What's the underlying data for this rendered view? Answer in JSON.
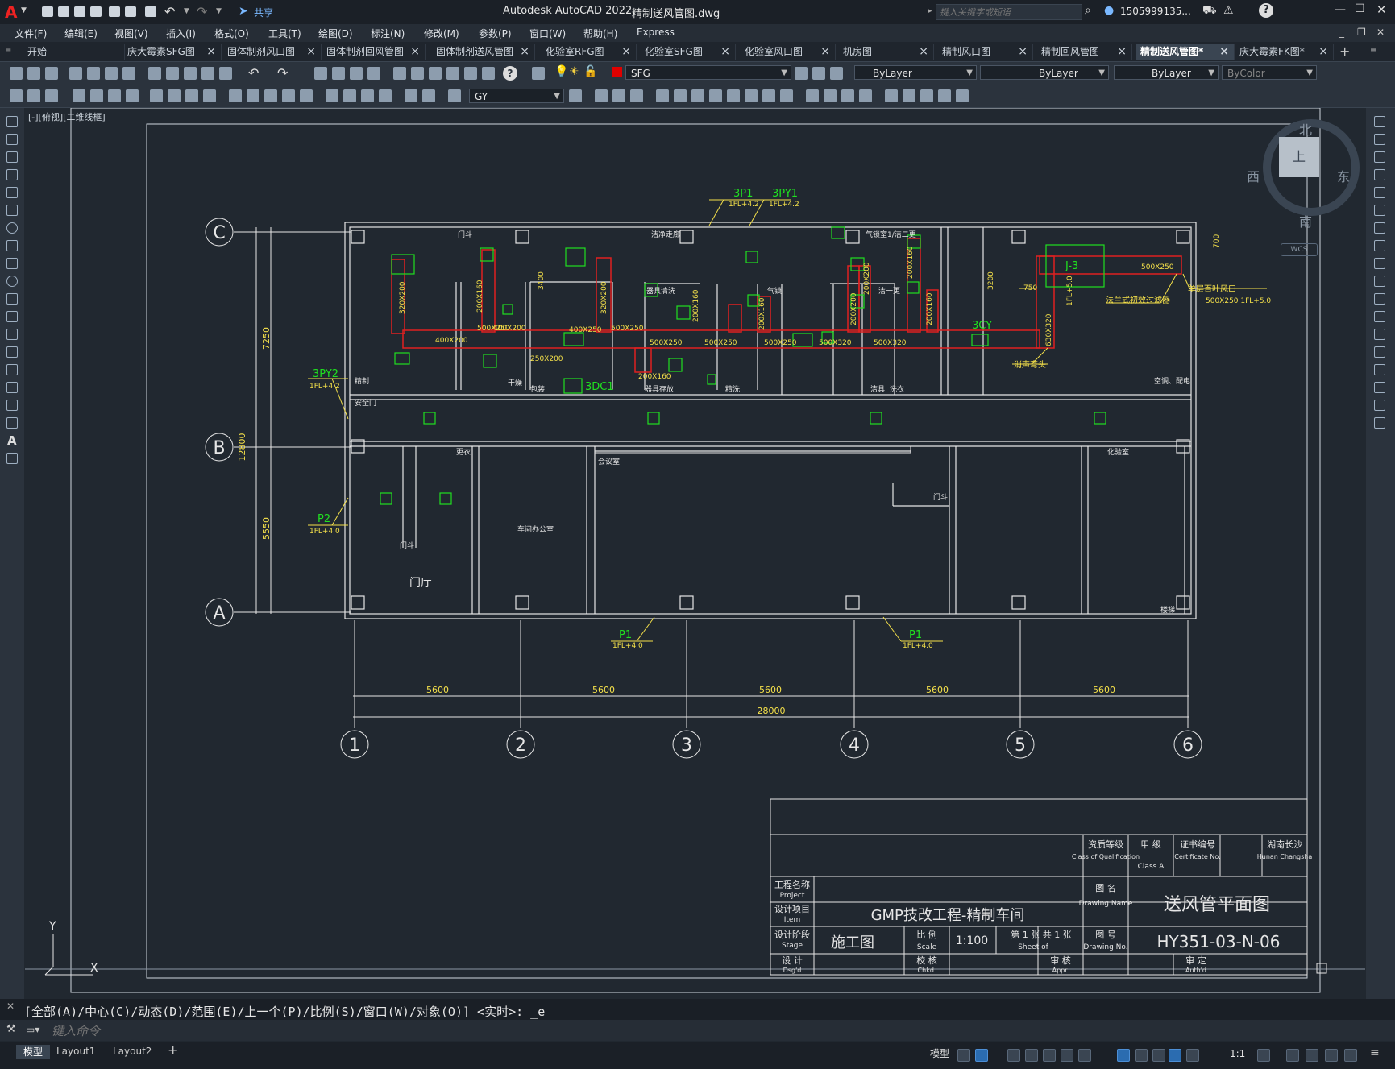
{
  "app": {
    "title": "Autodesk AutoCAD 2022",
    "file_name": "精制送风管图.dwg",
    "share_label": "共享",
    "search_placeholder": "键入关键字或短语",
    "user": "1505999135...",
    "logo_letter": "A"
  },
  "menu": [
    "文件(F)",
    "编辑(E)",
    "视图(V)",
    "插入(I)",
    "格式(O)",
    "工具(T)",
    "绘图(D)",
    "标注(N)",
    "修改(M)",
    "参数(P)",
    "窗口(W)",
    "帮助(H)",
    "Express"
  ],
  "tabs": [
    {
      "label": "开始",
      "close": false,
      "active": false
    },
    {
      "label": "庆大霉素SFG图",
      "close": true,
      "active": false
    },
    {
      "label": "固体制剂风口图",
      "close": true,
      "active": false
    },
    {
      "label": "固体制剂回风管图",
      "close": true,
      "active": false
    },
    {
      "label": "固体制剂送风管图",
      "close": true,
      "active": false
    },
    {
      "label": "化验室RFG图",
      "close": true,
      "active": false
    },
    {
      "label": "化验室SFG图",
      "close": true,
      "active": false
    },
    {
      "label": "化验室风口图",
      "close": true,
      "active": false
    },
    {
      "label": "机房图",
      "close": true,
      "active": false
    },
    {
      "label": "精制风口图",
      "close": true,
      "active": false
    },
    {
      "label": "精制回风管图",
      "close": true,
      "active": false
    },
    {
      "label": "精制送风管图*",
      "close": true,
      "active": true
    },
    {
      "label": "庆大霉素FK图*",
      "close": true,
      "active": false
    }
  ],
  "toolbar": {
    "layer": "SFG",
    "color": "ByLayer",
    "linetype": "ByLayer",
    "lineweight": "ByLayer",
    "plotstyle": "ByColor",
    "textstyle": "GY",
    "layer_color": "#e00000"
  },
  "viewport": {
    "label": "[-][俯视][二维线框]",
    "viewcube": {
      "top": "上",
      "north": "北",
      "south": "南",
      "east": "东",
      "west": "西",
      "wcs": "WCS"
    },
    "ucs_x": "X",
    "ucs_y": "Y"
  },
  "drawing": {
    "grid_rows": [
      "C",
      "B",
      "A"
    ],
    "grid_cols": [
      "1",
      "2",
      "3",
      "4",
      "5",
      "6"
    ],
    "bay_dims": [
      "5600",
      "5600",
      "5600",
      "5600",
      "5600"
    ],
    "total_dim": "28000",
    "left_dims": {
      "top": "7250",
      "bottom": "5550",
      "total": "12800"
    },
    "duct_sizes": [
      "320X200",
      "200X160",
      "400X200",
      "400X200",
      "400X250",
      "320X200",
      "500X250",
      "250X200",
      "500X250",
      "500X250",
      "200X160",
      "200X160",
      "500X250",
      "500X320",
      "200X160",
      "200X200",
      "500X320",
      "200X200",
      "200X160",
      "630X320",
      "500X250",
      "200X160",
      "500X250"
    ],
    "equipment": [
      {
        "tag": "3P1",
        "elev": "1FL+4.2"
      },
      {
        "tag": "3PY1",
        "elev": "1FL+4.2"
      },
      {
        "tag": "3PY2",
        "elev": "1FL+4.2"
      },
      {
        "tag": "P2",
        "elev": "1FL+4.0"
      },
      {
        "tag": "P1",
        "elev": "1FL+4.0"
      },
      {
        "tag": "P1",
        "elev": "1FL+4.0"
      }
    ],
    "labels": {
      "j3": "J-3",
      "cy": "3CY",
      "dc1": "3DC1",
      "louver": "单层百叶风口",
      "louver_spec": "500X250  1FL+5.0",
      "filter": "法兰式初效过滤器",
      "silencer": "消声弯头",
      "elev_vertical": "1FL+5.0",
      "dim_750": "750",
      "dim_700": "700",
      "dim_3400": "3400",
      "dim_3200": "3200"
    },
    "rooms": [
      "门斗",
      "洁净走廊",
      "气锁室1/洁二更",
      "洁一更",
      "器具清洗",
      "气锁",
      "器具存放",
      "安全门",
      "干燥",
      "包装",
      "精制",
      "精洗",
      "洁具",
      "洗衣",
      "空调、配电",
      "更衣",
      "车间办公室",
      "门厅",
      "会议室",
      "门斗",
      "化验室",
      "楼梯",
      "门斗"
    ]
  },
  "title_block": {
    "qual_label": "资质等级",
    "qual_en": "Class of Qualification",
    "grade_label": "甲 级",
    "grade_en": "Class A",
    "cert_label": "证书编号",
    "cert_en": "Certificate No.",
    "location": "湖南长沙",
    "location_en": "Hunan Changsha",
    "project_label": "工程名称",
    "project_en": "Project",
    "item_label": "设计项目",
    "item_en": "Item",
    "project_name": "GMP技改工程-精制车间",
    "drawing_name_label": "图  名",
    "drawing_name_en": "Drawing Name",
    "drawing_name": "送风管平面图",
    "stage_label": "设计阶段",
    "stage_en": "Stage",
    "stage": "施工图",
    "scale_label": "比  例",
    "scale_en": "Scale",
    "scale": "1:100",
    "sheet_label": "第 1 张 共 1 张",
    "sheet_en": "Sheet    of",
    "drawing_no_label": "图  号",
    "drawing_no_en": "Drawing No.",
    "drawing_no": "HY351-03-N-06",
    "design_label": "设  计",
    "design_en": "Dsg'd",
    "check_label": "校  核",
    "check_en": "Chkd.",
    "review_label": "审  核",
    "review_en": "Appr.",
    "approve_label": "审  定",
    "approve_en": "Auth'd"
  },
  "command": {
    "history": "[全部(A)/中心(C)/动态(D)/范围(E)/上一个(P)/比例(S)/窗口(W)/对象(O)] <实时>: _e",
    "placeholder": "键入命令"
  },
  "status": {
    "layout_tabs": [
      "模型",
      "Layout1",
      "Layout2"
    ],
    "model_label": "模型",
    "scale": "1:1"
  }
}
